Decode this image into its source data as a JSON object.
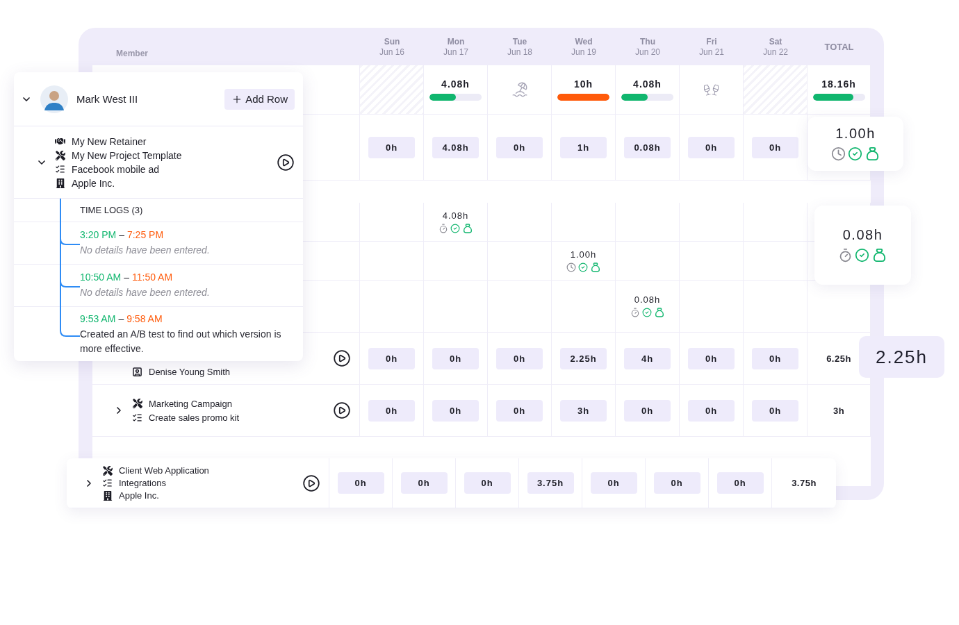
{
  "header": {
    "member_label": "Member",
    "days": [
      {
        "name": "Sun",
        "date": "Jun 16"
      },
      {
        "name": "Mon",
        "date": "Jun 17"
      },
      {
        "name": "Tue",
        "date": "Jun 18"
      },
      {
        "name": "Wed",
        "date": "Jun 19"
      },
      {
        "name": "Thu",
        "date": "Jun 20"
      },
      {
        "name": "Fri",
        "date": "Jun 21"
      },
      {
        "name": "Sat",
        "date": "Jun 22"
      }
    ],
    "total_label": "TOTAL"
  },
  "summary": {
    "days": [
      {
        "kind": "weekend"
      },
      {
        "kind": "hours",
        "hours": "4.08h",
        "level": 0.5,
        "color": "#10b66e"
      },
      {
        "kind": "holiday"
      },
      {
        "kind": "hours",
        "hours": "10h",
        "level": 1,
        "color": "#ff5a0a"
      },
      {
        "kind": "hours",
        "hours": "4.08h",
        "level": 0.5,
        "color": "#10b66e"
      },
      {
        "kind": "celebration"
      },
      {
        "kind": "weekend"
      }
    ],
    "total": {
      "hours": "18.16h",
      "level": 0.78,
      "color": "#10b66e"
    }
  },
  "rows": [
    {
      "kind": "entry",
      "chips": [
        "0h",
        "4.08h",
        "0h",
        "1h",
        "0.08h",
        "0h",
        "0h"
      ]
    },
    {
      "kind": "spacer"
    },
    {
      "kind": "log",
      "cells": [
        {
          "kind": "empty"
        },
        {
          "kind": "stopwatch",
          "hours": "4.08h"
        },
        {
          "kind": "empty"
        },
        {
          "kind": "empty"
        },
        {
          "kind": "empty"
        },
        {
          "kind": "empty"
        },
        {
          "kind": "empty"
        }
      ]
    },
    {
      "kind": "log",
      "cells": [
        {
          "kind": "empty"
        },
        {
          "kind": "empty"
        },
        {
          "kind": "empty"
        },
        {
          "kind": "clock",
          "hours": "1.00h"
        },
        {
          "kind": "empty"
        },
        {
          "kind": "empty"
        },
        {
          "kind": "empty"
        }
      ]
    },
    {
      "kind": "log",
      "cells": [
        {
          "kind": "empty"
        },
        {
          "kind": "empty"
        },
        {
          "kind": "empty"
        },
        {
          "kind": "empty"
        },
        {
          "kind": "stopwatch",
          "hours": "0.08h"
        },
        {
          "kind": "empty"
        },
        {
          "kind": "empty"
        }
      ]
    },
    {
      "kind": "entry",
      "lines": [
        {
          "kind": "contact",
          "text": "Denise Young Smith"
        }
      ],
      "chips": [
        "0h",
        "0h",
        "0h",
        "2.25h",
        "4h",
        "0h",
        "0h"
      ],
      "total": "6.25h"
    },
    {
      "kind": "entry",
      "expanded": false,
      "lines": [
        {
          "kind": "project",
          "text": "Marketing Campaign"
        },
        {
          "kind": "task",
          "text": "Create sales promo kit"
        }
      ],
      "chips": [
        "0h",
        "0h",
        "0h",
        "3h",
        "0h",
        "0h",
        "0h"
      ],
      "total": "3h"
    },
    {
      "kind": "spacer"
    }
  ],
  "popup": {
    "member": {
      "name": "Mark West III",
      "expanded": true
    },
    "add_row": "Add Row",
    "group": {
      "expanded": true,
      "lines": [
        {
          "kind": "retainer",
          "text": "My New Retainer"
        },
        {
          "kind": "project",
          "text": "My New Project Template"
        },
        {
          "kind": "task",
          "text": "Facebook mobile ad"
        },
        {
          "kind": "client",
          "text": "Apple Inc."
        }
      ]
    },
    "time_logs": {
      "title": "TIME LOGS (3)",
      "entries": [
        {
          "kind": "empty",
          "start": "3:20 PM",
          "separator": "–",
          "end": "7:25 PM",
          "note": "No details have been entered."
        },
        {
          "kind": "empty",
          "start": "10:50 AM",
          "separator": "–",
          "end": "11:50 AM",
          "note": "No details have been entered."
        },
        {
          "kind": "text",
          "start": "9:53 AM",
          "separator": "–",
          "end": "9:58 AM",
          "note": "Created an A/B test to find out which version is more effective."
        }
      ]
    }
  },
  "floating_totals": [
    {
      "hours": "1.00h",
      "kind": "clock"
    },
    {
      "hours": "0.08h",
      "kind": "stopwatch"
    }
  ],
  "highlight": {
    "hours": "2.25h"
  },
  "bottom_row": {
    "expanded": false,
    "lines": [
      {
        "kind": "project",
        "text": "Client Web Application"
      },
      {
        "kind": "task",
        "text": "Integrations"
      },
      {
        "kind": "client",
        "text": "Apple Inc."
      }
    ],
    "chips": [
      "0h",
      "0h",
      "0h",
      "3.75h",
      "0h",
      "0h",
      "0h"
    ],
    "total": "3.75h"
  }
}
